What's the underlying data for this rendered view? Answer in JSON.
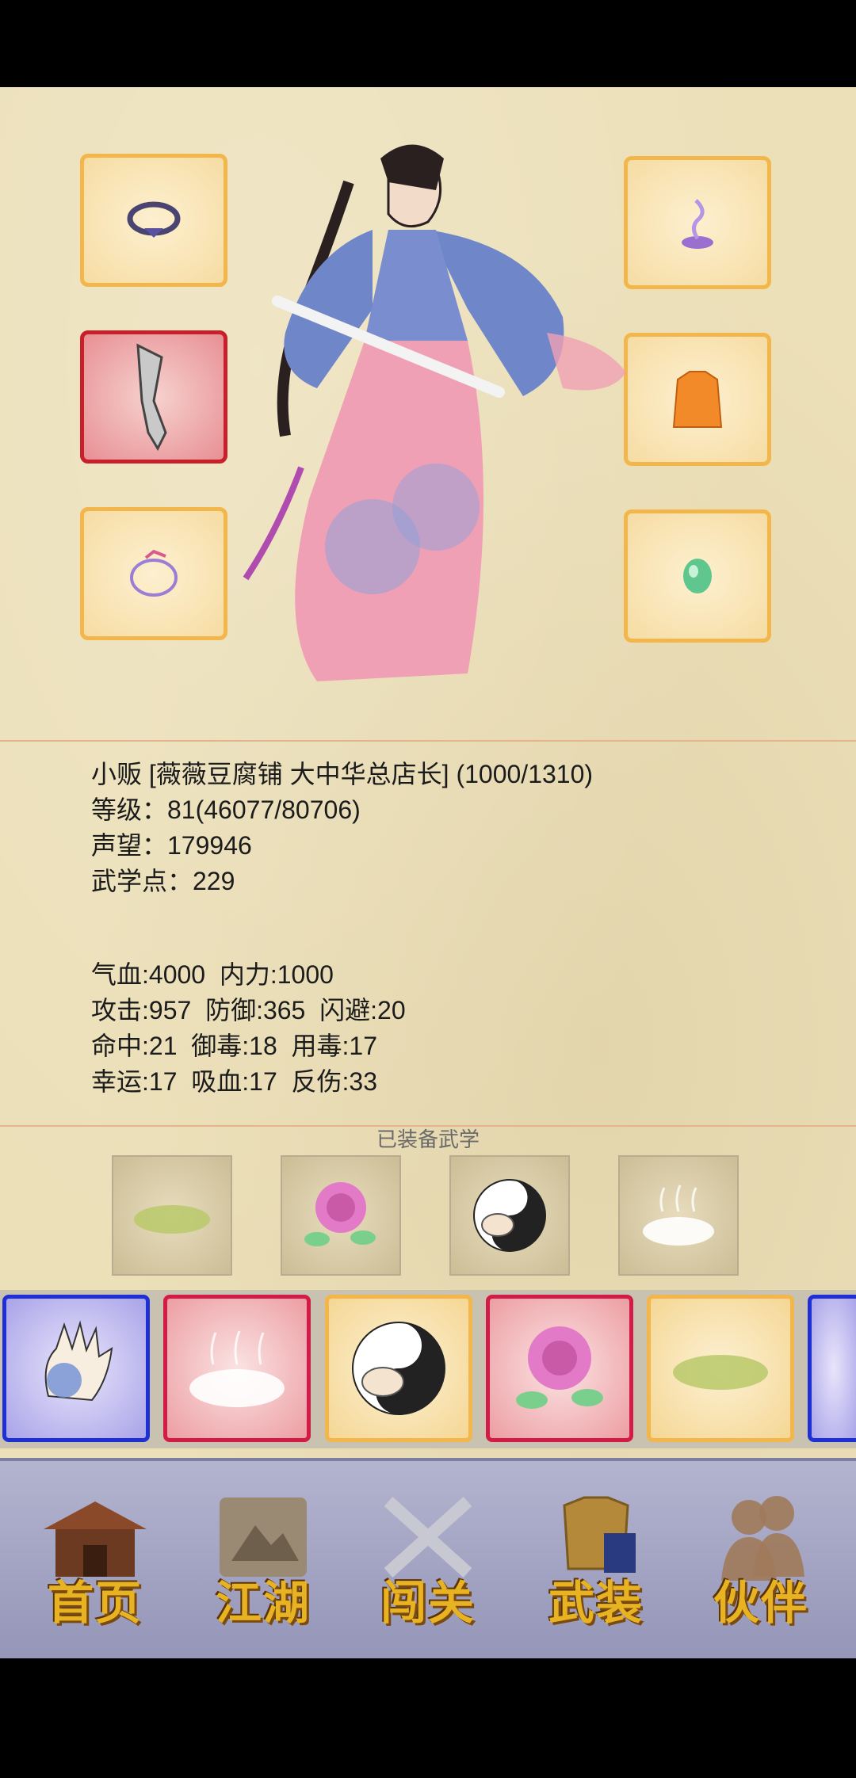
{
  "character": {
    "title_line": "小贩 [薇薇豆腐铺 大中华总店长] (1000/1310)",
    "level_line": "等级：81(46077/80706)",
    "reputation_line": "声望：179946",
    "martial_points_line": "武学点：229"
  },
  "stats": {
    "row1": "气血:4000  内力:1000",
    "row2": "攻击:957  防御:365  闪避:20",
    "row3": "命中:21  御毒:18  用毒:17",
    "row4": "幸运:17  吸血:17  反伤:33"
  },
  "equipped_martial": {
    "title": "已装备武学"
  },
  "nav": {
    "home": "首页",
    "jianghu": "江湖",
    "challenge": "闯关",
    "equipment": "武装",
    "partner": "伙伴"
  },
  "colors": {
    "paper": "#ece0b9",
    "slot_border": "#f2b64a",
    "weapon_slot_border": "#c8202a",
    "card_blue": "#1f2fd6",
    "card_red": "#d21b48",
    "nav_label": "#e7b323"
  }
}
